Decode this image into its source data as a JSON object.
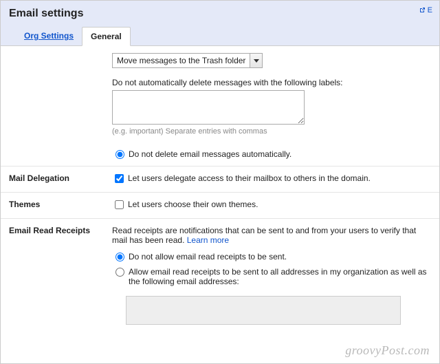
{
  "page_title": "Email settings",
  "popout_label": "E",
  "tabs": {
    "org": "Org Settings",
    "general": "General"
  },
  "auto_delete": {
    "select_value": "Move messages to the Trash folder",
    "labels_prompt": "Do not automatically delete messages with the following labels:",
    "labels_value": "",
    "labels_hint": "(e.g. important) Separate entries with commas",
    "radio_do_not_delete": "Do not delete email messages automatically."
  },
  "mail_delegation": {
    "section": "Mail Delegation",
    "checkbox": "Let users delegate access to their mailbox to others in the domain."
  },
  "themes": {
    "section": "Themes",
    "checkbox": "Let users choose their own themes."
  },
  "receipts": {
    "section": "Email Read Receipts",
    "desc": "Read receipts are notifications that can be sent to and from your users to verify that mail has been read. ",
    "learn_more": "Learn more",
    "opt_disallow": "Do not allow email read receipts to be sent.",
    "opt_allow": "Allow email read receipts to be sent to all addresses in my organization as well as the following email addresses:",
    "addresses_value": ""
  },
  "watermark": "groovyPost.com"
}
